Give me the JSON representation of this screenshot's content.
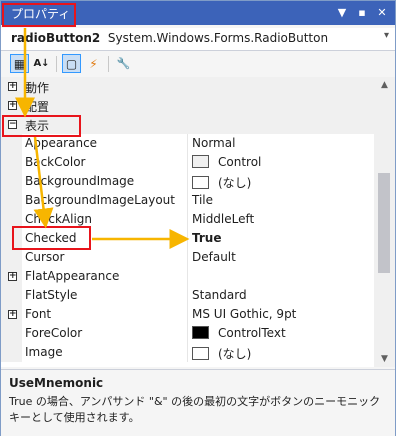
{
  "titlebar": {
    "title": "プロパティ",
    "controls": {
      "dropdown": "▼",
      "pin": "▪",
      "close": "✕"
    }
  },
  "object_selector": {
    "name": "radioButton2",
    "type": "System.Windows.Forms.RadioButton",
    "arrow": "▾"
  },
  "toolbar": {
    "buttons": [
      {
        "name": "categorized-icon",
        "glyph": "▦",
        "active": true
      },
      {
        "name": "alphabetical-icon",
        "glyph": "A↓",
        "active": false
      },
      {
        "name": "properties-icon",
        "glyph": "▢",
        "active": true
      },
      {
        "name": "events-icon",
        "glyph": "⚡",
        "active": false
      },
      {
        "name": "property-pages-icon",
        "glyph": "🔧",
        "active": false
      }
    ]
  },
  "grid": {
    "categories": {
      "behavior": {
        "label": "動作",
        "expander": "+"
      },
      "layout": {
        "label": "配置",
        "expander": "+"
      },
      "appearance": {
        "label": "表示",
        "expander": "−"
      }
    },
    "rows": [
      {
        "name": "Appearance",
        "value": "Normal"
      },
      {
        "name": "BackColor",
        "value": "Control",
        "swatch": "#f0f0f0"
      },
      {
        "name": "BackgroundImage",
        "value": "(なし)",
        "swatch": "#ffffff"
      },
      {
        "name": "BackgroundImageLayout",
        "value": "Tile"
      },
      {
        "name": "CheckAlign",
        "value": "MiddleLeft"
      },
      {
        "name": "Checked",
        "value": "True"
      },
      {
        "name": "Cursor",
        "value": "Default"
      },
      {
        "name": "FlatAppearance",
        "value": "",
        "expander": "+"
      },
      {
        "name": "FlatStyle",
        "value": "Standard"
      },
      {
        "name": "Font",
        "value": "MS UI Gothic, 9pt",
        "expander": "+"
      },
      {
        "name": "ForeColor",
        "value": "ControlText",
        "swatch": "#000000"
      },
      {
        "name": "Image",
        "value": "(なし)",
        "swatch": "#ffffff"
      }
    ]
  },
  "scrollbar": {
    "up": "▲",
    "down": "▼"
  },
  "description": {
    "title": "UseMnemonic",
    "text": "True の場合、アンパサンド \"&\" の後の最初の文字がボタンのニーモニック キーとして使用されます。"
  },
  "colors": {
    "titlebar": "#3c63b9",
    "highlight": "#e8141b",
    "arrow": "#f7b500"
  }
}
